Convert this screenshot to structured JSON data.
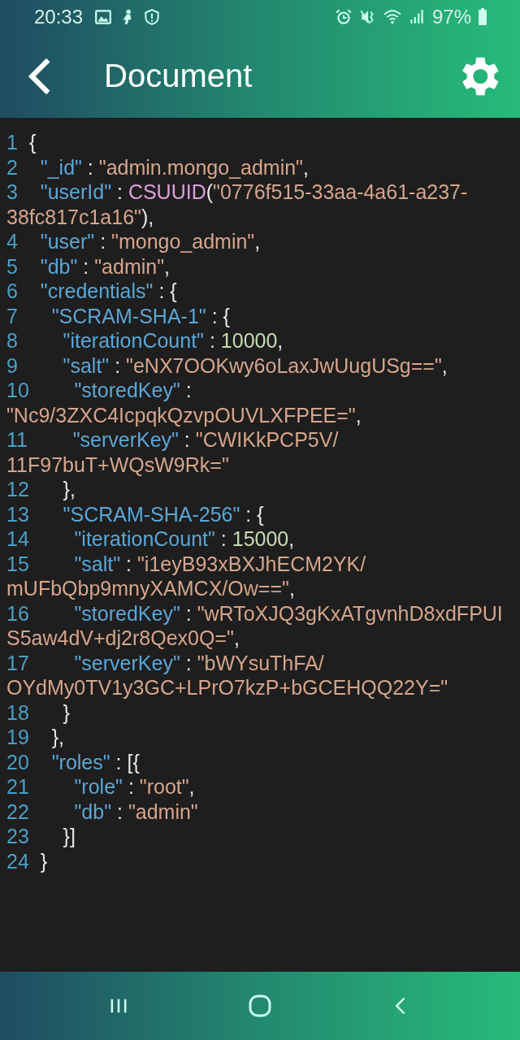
{
  "status_bar": {
    "time": "20:33",
    "battery": "97%"
  },
  "app_bar": {
    "title": "Document"
  },
  "code_lines": [
    {
      "number": "1",
      "tokens": [
        {
          "kind": "punct",
          "text": "{"
        }
      ]
    },
    {
      "number": "2",
      "tokens": [
        {
          "kind": "key",
          "text": "  \"_id\""
        },
        {
          "kind": "punct",
          "text": " : "
        },
        {
          "kind": "string",
          "text": "\"admin.mongo_admin\""
        },
        {
          "kind": "punct",
          "text": ","
        }
      ]
    },
    {
      "number": "3",
      "tokens": [
        {
          "kind": "key",
          "text": "  \"userId\""
        },
        {
          "kind": "punct",
          "text": " : "
        },
        {
          "kind": "function",
          "text": "CSUUID"
        },
        {
          "kind": "punct",
          "text": "("
        },
        {
          "kind": "string",
          "text": "\"0776f515-33aa-4a61-a237-"
        },
        {
          "kind": "string",
          "text": "38fc817c1a16\"",
          "wrapped": true
        },
        {
          "kind": "punct",
          "text": "),"
        }
      ]
    },
    {
      "number": "4",
      "tokens": [
        {
          "kind": "key",
          "text": "  \"user\""
        },
        {
          "kind": "punct",
          "text": " : "
        },
        {
          "kind": "string",
          "text": "\"mongo_admin\""
        },
        {
          "kind": "punct",
          "text": ","
        }
      ]
    },
    {
      "number": "5",
      "tokens": [
        {
          "kind": "key",
          "text": "  \"db\""
        },
        {
          "kind": "punct",
          "text": " : "
        },
        {
          "kind": "string",
          "text": "\"admin\""
        },
        {
          "kind": "punct",
          "text": ","
        }
      ]
    },
    {
      "number": "6",
      "tokens": [
        {
          "kind": "key",
          "text": "  \"credentials\""
        },
        {
          "kind": "punct",
          "text": " : {"
        }
      ]
    },
    {
      "number": "7",
      "tokens": [
        {
          "kind": "key",
          "text": "    \"SCRAM-SHA-1\""
        },
        {
          "kind": "punct",
          "text": " : {"
        }
      ]
    },
    {
      "number": "8",
      "tokens": [
        {
          "kind": "key",
          "text": "      \"iterationCount\""
        },
        {
          "kind": "punct",
          "text": " : "
        },
        {
          "kind": "number",
          "text": "10000"
        },
        {
          "kind": "punct",
          "text": ","
        }
      ]
    },
    {
      "number": "9",
      "tokens": [
        {
          "kind": "key",
          "text": "      \"salt\""
        },
        {
          "kind": "punct",
          "text": " : "
        },
        {
          "kind": "string",
          "text": "\"eNX7OOKwy6oLaxJwUugUSg==\""
        },
        {
          "kind": "punct",
          "text": ","
        }
      ]
    },
    {
      "number": "10",
      "tokens": [
        {
          "kind": "key",
          "text": "      \"storedKey\""
        },
        {
          "kind": "punct",
          "text": " :"
        },
        {
          "kind": "string",
          "text": "\"Nc9/3ZXC4IcpqkQzvpOUVLXFPEE=\"",
          "wrapped": true
        },
        {
          "kind": "punct",
          "text": ","
        }
      ]
    },
    {
      "number": "11",
      "tokens": [
        {
          "kind": "key",
          "text": "      \"serverKey\""
        },
        {
          "kind": "punct",
          "text": " : "
        },
        {
          "kind": "string",
          "text": "\"CWIKkPCP5V/"
        },
        {
          "kind": "string",
          "text": "11F97buT+WQsW9Rk=\"",
          "wrapped": true
        }
      ]
    },
    {
      "number": "12",
      "tokens": [
        {
          "kind": "punct",
          "text": "    },"
        }
      ]
    },
    {
      "number": "13",
      "tokens": [
        {
          "kind": "key",
          "text": "    \"SCRAM-SHA-256\""
        },
        {
          "kind": "punct",
          "text": " : {"
        }
      ]
    },
    {
      "number": "14",
      "tokens": [
        {
          "kind": "key",
          "text": "      \"iterationCount\""
        },
        {
          "kind": "punct",
          "text": " : "
        },
        {
          "kind": "number",
          "text": "15000"
        },
        {
          "kind": "punct",
          "text": ","
        }
      ]
    },
    {
      "number": "15",
      "tokens": [
        {
          "kind": "key",
          "text": "      \"salt\""
        },
        {
          "kind": "punct",
          "text": " : "
        },
        {
          "kind": "string",
          "text": "\"i1eyB93xBXJhECM2YK/"
        },
        {
          "kind": "string",
          "text": "mUFbQbp9mnyXAMCX/Ow==\"",
          "wrapped": true
        },
        {
          "kind": "punct",
          "text": ","
        }
      ]
    },
    {
      "number": "16",
      "tokens": [
        {
          "kind": "key",
          "text": "      \"storedKey\""
        },
        {
          "kind": "punct",
          "text": " : "
        },
        {
          "kind": "string",
          "text": "\"wRToXJQ3gKxATgvnhD8xdFPUI"
        },
        {
          "kind": "string",
          "text": "S5aw4dV+dj2r8Qex0Q=\"",
          "wrapped": true
        },
        {
          "kind": "punct",
          "text": ","
        }
      ]
    },
    {
      "number": "17",
      "tokens": [
        {
          "kind": "key",
          "text": "      \"serverKey\""
        },
        {
          "kind": "punct",
          "text": " : "
        },
        {
          "kind": "string",
          "text": "\"bWYsuThFA/"
        },
        {
          "kind": "string",
          "text": "OYdMy0TV1y3GC+LPrO7kzP+bGCEHQQ22Y=\"",
          "wrapped": true
        }
      ]
    },
    {
      "number": "18",
      "tokens": [
        {
          "kind": "punct",
          "text": "    }"
        }
      ]
    },
    {
      "number": "19",
      "tokens": [
        {
          "kind": "punct",
          "text": "  },"
        }
      ]
    },
    {
      "number": "20",
      "tokens": [
        {
          "kind": "key",
          "text": "  \"roles\""
        },
        {
          "kind": "punct",
          "text": " : [{"
        }
      ]
    },
    {
      "number": "21",
      "tokens": [
        {
          "kind": "key",
          "text": "      \"role\""
        },
        {
          "kind": "punct",
          "text": " : "
        },
        {
          "kind": "string",
          "text": "\"root\""
        },
        {
          "kind": "punct",
          "text": ","
        }
      ]
    },
    {
      "number": "22",
      "tokens": [
        {
          "kind": "key",
          "text": "      \"db\""
        },
        {
          "kind": "punct",
          "text": " : "
        },
        {
          "kind": "string",
          "text": "\"admin\""
        }
      ]
    },
    {
      "number": "23",
      "tokens": [
        {
          "kind": "punct",
          "text": "    }]"
        }
      ]
    },
    {
      "number": "24",
      "tokens": [
        {
          "kind": "punct",
          "text": "}"
        }
      ]
    }
  ]
}
